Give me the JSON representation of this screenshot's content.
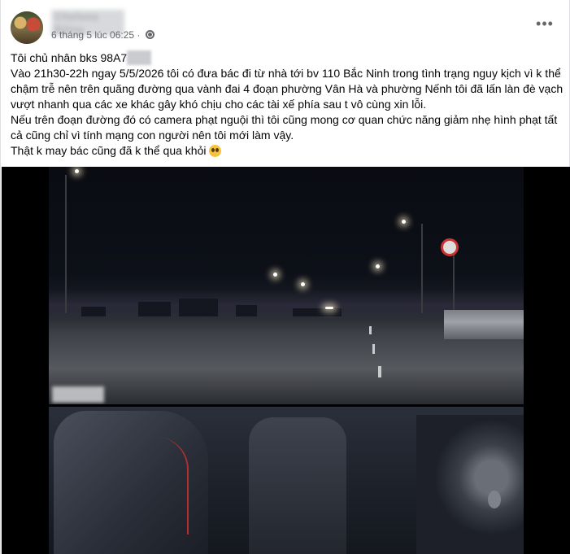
{
  "post": {
    "author_name": "Chelsea Đông",
    "timestamp": "6 tháng 5 lúc 06:25",
    "separator": "·",
    "privacy_icon": "globe-icon",
    "more_icon": "more-options-icon",
    "more_label": "•••",
    "lines": {
      "l1_prefix": "Tôi chủ nhân bks 98A7",
      "l2": "Vào 21h30-22h ngay 5/5/2026 tôi có đưa bác đi từ nhà tới bv 110 Bắc Ninh trong tình trạng nguy kịch vì k thể chậm trễ nên trên quãng đường qua vành đai 4 đoạn phường Vân Hà và phường Nếnh tôi đã lấn làn đè vạch vượt nhanh qua các xe khác gây khó chịu cho các tài xế phía sau t vô cùng xin lỗi.",
      "l3": "Nếu trên đoạn đường đó có camera phạt nguội thì tôi cũng mong cơ quan chức năng giảm nhẹ hình phạt tất cả cũng chỉ vì tính mạng con người nên tôi mới làm vậy.",
      "l4": "Thật k may bác cũng đã k thể qua khỏi"
    },
    "emoji_icon": "pleading-face-emoji-icon"
  }
}
